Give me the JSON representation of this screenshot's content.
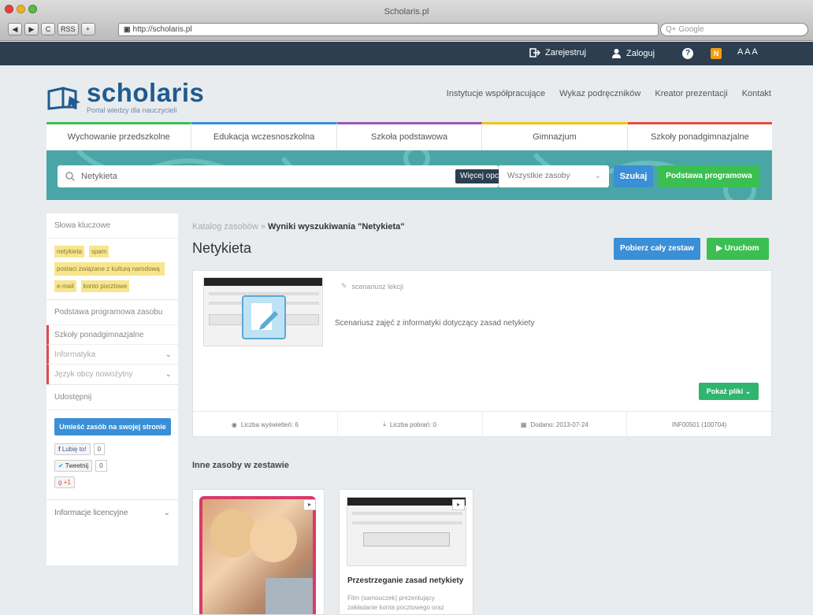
{
  "browser": {
    "title": "Scholaris.pl",
    "url": "http://scholaris.pl",
    "search_placeholder": "Q+ Google",
    "nav_buttons": [
      "◀",
      "▶",
      "C",
      "RSS",
      "+"
    ]
  },
  "topbar": {
    "register": "Zarejestruj",
    "login": "Zaloguj",
    "help": "?",
    "rss": "N",
    "font_sizes": "A A A"
  },
  "header": {
    "logo": "scholaris",
    "logo_sub": "Portal wiedzy dla nauczycieli",
    "nav": [
      "Instytucje współpracujące",
      "Wykaz podręczników",
      "Kreator prezentacji",
      "Kontakt"
    ]
  },
  "categories": [
    {
      "label": "Wychowanie przedszkolne",
      "color": "#3bbf53"
    },
    {
      "label": "Edukacja wczesnoszkolna",
      "color": "#3a8fd6"
    },
    {
      "label": "Szkoła podstawowa",
      "color": "#9b59b6"
    },
    {
      "label": "Gimnazjum",
      "color": "#f1c40f"
    },
    {
      "label": "Szkoły ponadgimnazjalne",
      "color": "#e74c3c"
    }
  ],
  "search": {
    "value": "Netykieta",
    "more_options": "Więcej opcji...",
    "scope": "Wszystkie zasoby",
    "submit": "Szukaj",
    "curriculum": "Podstawa programowa"
  },
  "sidebar": {
    "keywords_title": "Słowa kluczowe",
    "tags": [
      "netykieta",
      "spam",
      "postaci związane z kulturą narodową",
      "e-mail",
      "konto pocztowe"
    ],
    "curriculum_title": "Podstawa programowa zasobu",
    "school_level": "Szkoły ponadgimnazjalne",
    "subjects": [
      "Informatyka",
      "Język obcy nowożytny"
    ],
    "share_title": "Udostępnij",
    "embed_button": "Umieść zasób na swojej stronie",
    "like_label": "Lubię to!",
    "like_count": "0",
    "tweet_label": "Tweetnij",
    "tweet_count": "0",
    "gplus_label": "+1",
    "license_title": "Informacje licencyjne"
  },
  "main": {
    "breadcrumb_link": "Katalog zasobów",
    "breadcrumb_current": "Wyniki wyszukiwania \"Netykieta\"",
    "title": "Netykieta",
    "download_button": "Pobierz cały zestaw",
    "run_button": "Uruchom",
    "resource": {
      "type": "scenariusz lekcji",
      "description": "Scenariusz zajęć z informatyki dotyczący zasad netykiety",
      "files_button": "Pokaż pliki",
      "views": "Liczba wyświetleń: 6",
      "downloads": "Liczba pobrań: 0",
      "added": "Dodano: 2013-07-24",
      "id": "INF00501 (100704)"
    },
    "others_title": "Inne zasoby w zestawie",
    "others": [
      {
        "title": "",
        "desc": ""
      },
      {
        "title": "Przestrzeganie zasad netykiety",
        "desc": "Film (samouczek) prezentujący zakładanie konta pocztowego oraz"
      }
    ]
  }
}
